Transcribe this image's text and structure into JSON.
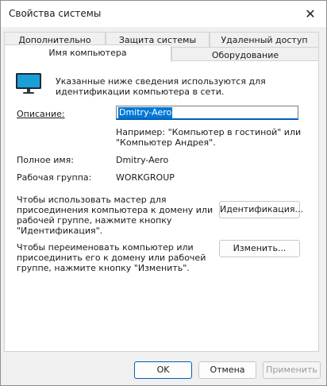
{
  "window": {
    "title": "Свойства системы",
    "close_glyph": "✕"
  },
  "tabs": {
    "row1": [
      "Дополнительно",
      "Защита системы",
      "Удаленный доступ"
    ],
    "row2": [
      "Имя компьютера",
      "Оборудование"
    ],
    "active": "Имя компьютера"
  },
  "computer_name": {
    "intro_line1": "Указанные ниже сведения используются для",
    "intro_line2": "идентификации компьютера в сети.",
    "description_label": "Описание:",
    "description_value": "Dmitry-Aero",
    "example_line1": "Например: \"Компьютер в гостиной\" или",
    "example_line2": "\"Компьютер Андрея\".",
    "full_name_label": "Полное имя:",
    "full_name_value": "Dmitry-Aero",
    "workgroup_label": "Рабочая группа:",
    "workgroup_value": "WORKGROUP",
    "wizard_text_line1": "Чтобы использовать мастер для",
    "wizard_text_line2": "присоединения компьютера к домену или",
    "wizard_text_line3": "рабочей группе, нажмите кнопку",
    "wizard_text_line4": "\"Идентификация\".",
    "identify_button": "Идентификация...",
    "rename_text_line1": "Чтобы переименовать компьютер или",
    "rename_text_line2": "присоединить его к домену или рабочей",
    "rename_text_line3": "группе, нажмите кнопку \"Изменить\".",
    "change_button": "Изменить..."
  },
  "footer": {
    "ok": "OK",
    "cancel": "Отмена",
    "apply": "Применить"
  },
  "colors": {
    "accent": "#0078d4",
    "focus_border": "#005fb8"
  }
}
